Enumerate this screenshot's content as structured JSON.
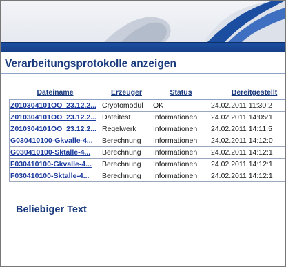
{
  "page": {
    "title": "Verarbeitungsprotokolle anzeigen",
    "free_text": "Beliebiger Text"
  },
  "colors": {
    "brand_blue": "#1b4ea1",
    "title_text": "#1a3a7e",
    "link_text": "#1a3a9e"
  },
  "table": {
    "headers": {
      "file": "Dateiname",
      "generator": "Erzeuger",
      "status": "Status",
      "provided": "Bereitgestellt"
    },
    "rows": [
      {
        "file": "Z010304101OO_23.12.2...",
        "generator": "Cryptomodul",
        "status": "OK",
        "provided": "24.02.2011 11:30:2"
      },
      {
        "file": "Z010304101OO_23.12.2...",
        "generator": "Dateitest",
        "status": "Informationen",
        "provided": "24.02.2011 14:05:1"
      },
      {
        "file": "Z010304101OO_23.12.2...",
        "generator": "Regelwerk",
        "status": "Informationen",
        "provided": "24.02.2011 14:11:5"
      },
      {
        "file": "G030410100-Gkvalle-4...",
        "generator": "Berechnung",
        "status": "Informationen",
        "provided": "24.02.2011 14:12:0"
      },
      {
        "file": "G030410100-Sktalle-4...",
        "generator": "Berechnung",
        "status": "Informationen",
        "provided": "24.02.2011 14:12:1"
      },
      {
        "file": "F030410100-Gkvalle-4...",
        "generator": "Berechnung",
        "status": "Informationen",
        "provided": "24.02.2011 14:12:1"
      },
      {
        "file": "F030410100-Sktalle-4...",
        "generator": "Berechnung",
        "status": "Informationen",
        "provided": "24.02.2011 14:12:1"
      }
    ]
  }
}
